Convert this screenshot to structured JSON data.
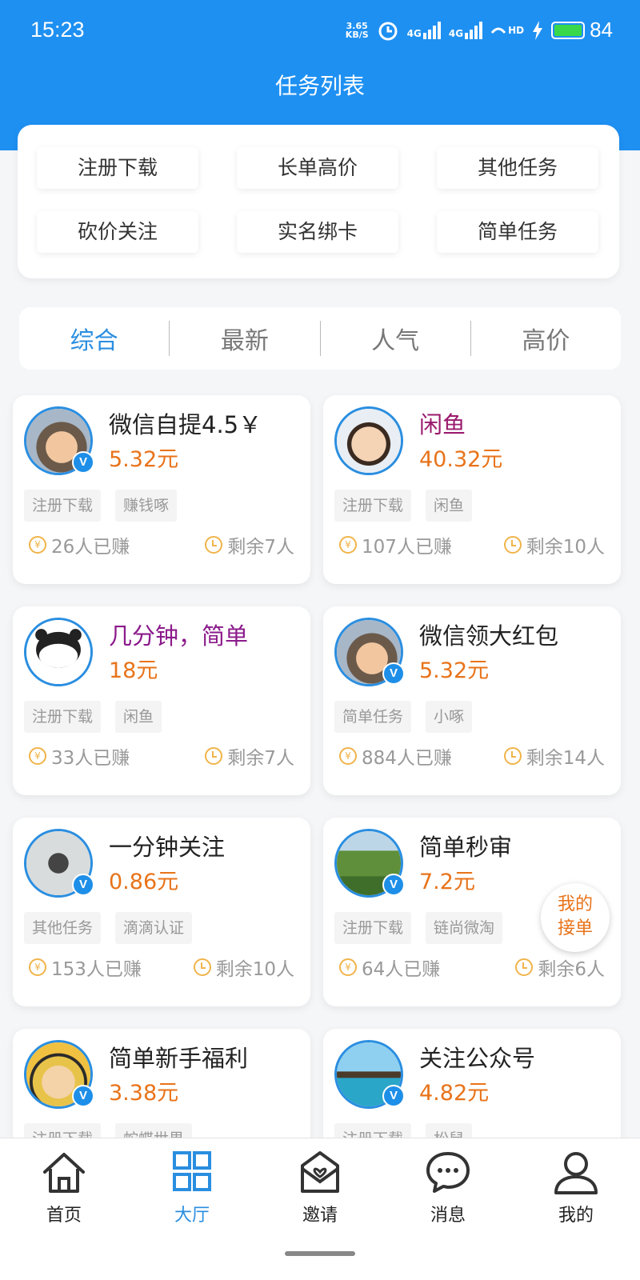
{
  "status_bar": {
    "time": "15:23",
    "net_speed_value": "3.65",
    "net_speed_unit": "KB/S",
    "signal_1": "4G",
    "signal_2": "4G",
    "hd": "HD",
    "battery_level": "84"
  },
  "header": {
    "title": "任务列表"
  },
  "categories": [
    {
      "label": "注册下载"
    },
    {
      "label": "长单高价"
    },
    {
      "label": "其他任务"
    },
    {
      "label": "砍价关注"
    },
    {
      "label": "实名绑卡"
    },
    {
      "label": "简单任务"
    }
  ],
  "sort_tabs": [
    {
      "label": "综合",
      "active": true
    },
    {
      "label": "最新"
    },
    {
      "label": "人气"
    },
    {
      "label": "高价"
    }
  ],
  "tasks": [
    {
      "title": "微信自提4.5￥",
      "price": "5.32元",
      "tags": [
        "注册下载",
        "赚钱啄"
      ],
      "earned": "26人已赚",
      "remaining": "剩余7人",
      "verified": "V"
    },
    {
      "title": "闲鱼",
      "title_color": "#9a1a6e",
      "price": "40.32元",
      "tags": [
        "注册下载",
        "闲鱼"
      ],
      "earned": "107人已赚",
      "remaining": "剩余10人"
    },
    {
      "title": "几分钟，简单",
      "title_color": "#8b1a8b",
      "price": "18元",
      "tags": [
        "注册下载",
        "闲鱼"
      ],
      "earned": "33人已赚",
      "remaining": "剩余7人"
    },
    {
      "title": "微信领大红包",
      "price": "5.32元",
      "tags": [
        "简单任务",
        "小啄"
      ],
      "earned": "884人已赚",
      "remaining": "剩余14人",
      "verified": "V"
    },
    {
      "title": "一分钟关注",
      "price": "0.86元",
      "tags": [
        "其他任务",
        "滴滴认证"
      ],
      "earned": "153人已赚",
      "remaining": "剩余10人",
      "verified": "V"
    },
    {
      "title": "简单秒审",
      "price": "7.2元",
      "tags": [
        "注册下载",
        "链尚微淘"
      ],
      "earned": "64人已赚",
      "remaining": "剩余6人",
      "verified": "V"
    },
    {
      "title": "简单新手福利",
      "price": "3.38元",
      "tags": [
        "注册下载",
        "蛇蝶世界"
      ],
      "verified": "V"
    },
    {
      "title": "关注公众号",
      "price": "4.82元",
      "tags": [
        "注册下载",
        "松鼠"
      ],
      "verified": "V"
    }
  ],
  "float_button": {
    "line1": "我的",
    "line2": "接单"
  },
  "bottom_nav": [
    {
      "label": "首页",
      "icon": "home-icon"
    },
    {
      "label": "大厅",
      "icon": "grid-icon",
      "active": true
    },
    {
      "label": "邀请",
      "icon": "invite-envelope-icon"
    },
    {
      "label": "消息",
      "icon": "chat-bubble-icon"
    },
    {
      "label": "我的",
      "icon": "user-icon"
    }
  ],
  "colors": {
    "primary": "#1e90f2",
    "accent": "#2a8ee0",
    "price": "#e8731a",
    "coin": "#f0b44a"
  }
}
